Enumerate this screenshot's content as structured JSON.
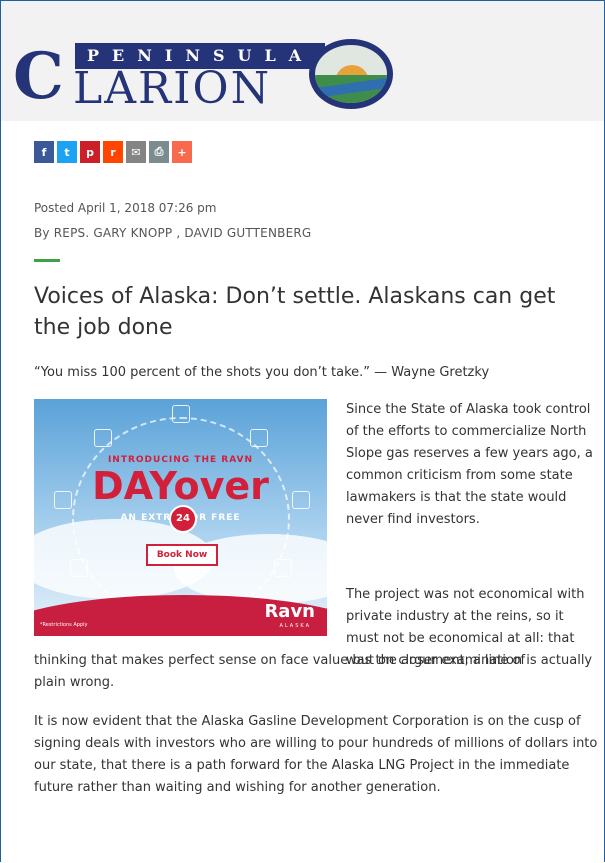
{
  "masthead": {
    "logo_letter": "C",
    "logo_top": "PENINSULA",
    "logo_word": "LARION"
  },
  "share": {
    "buttons": [
      {
        "label": "f",
        "name": "facebook",
        "color": "#3b5998"
      },
      {
        "label": "t",
        "name": "twitter",
        "color": "#1da1f2"
      },
      {
        "label": "p",
        "name": "pinterest",
        "color": "#cb2027"
      },
      {
        "label": "r",
        "name": "reddit",
        "color": "#ff4500"
      },
      {
        "label": "✉",
        "name": "email",
        "color": "#848484"
      },
      {
        "label": "⎙",
        "name": "print",
        "color": "#7a8c8e"
      },
      {
        "label": "+",
        "name": "more",
        "color": "#f8694d"
      }
    ]
  },
  "article": {
    "posted": "Posted April 1, 2018 07:26 pm",
    "by_label": "By",
    "authors": "REPS. GARY KNOPP ,  DAVID GUTTENBERG",
    "title": "Voices of Alaska: Don’t settle. Alaskans can get the job done",
    "quote": "“You miss 100 percent of the shots you don’t take.” — Wayne Gretzky",
    "p1": "Since the State of Alaska took control of the efforts to commercialize North Slope gas reserves a few years ago, a common criticism from some state lawmakers is that the state would never find investors.",
    "p2_part1": "The project was not economical with private industry at the reins, so it must not be economical at all: that was the argument, a line of",
    "p2_part2": "thinking that makes perfect sense on face value but on closer examination is actually plain wrong.",
    "p3": "It is now evident that the Alaska Gasline Development Corporation is on the cusp of signing deals with investors who are willing to pour hundreds of millions of dollars into our state, that there is a path forward for the Alaska LNG Project in the immediate future rather than waiting and wishing for another generation."
  },
  "ad": {
    "intro": "INTRODUCING THE RAVN",
    "headline": "DAYover",
    "extra": "AN EXTRA      FOR FREE",
    "badge": "24",
    "cta": "Book Now",
    "fine_print": "*Restrictions Apply",
    "brand": "Ravn",
    "brand_sub": "ALASKA"
  }
}
